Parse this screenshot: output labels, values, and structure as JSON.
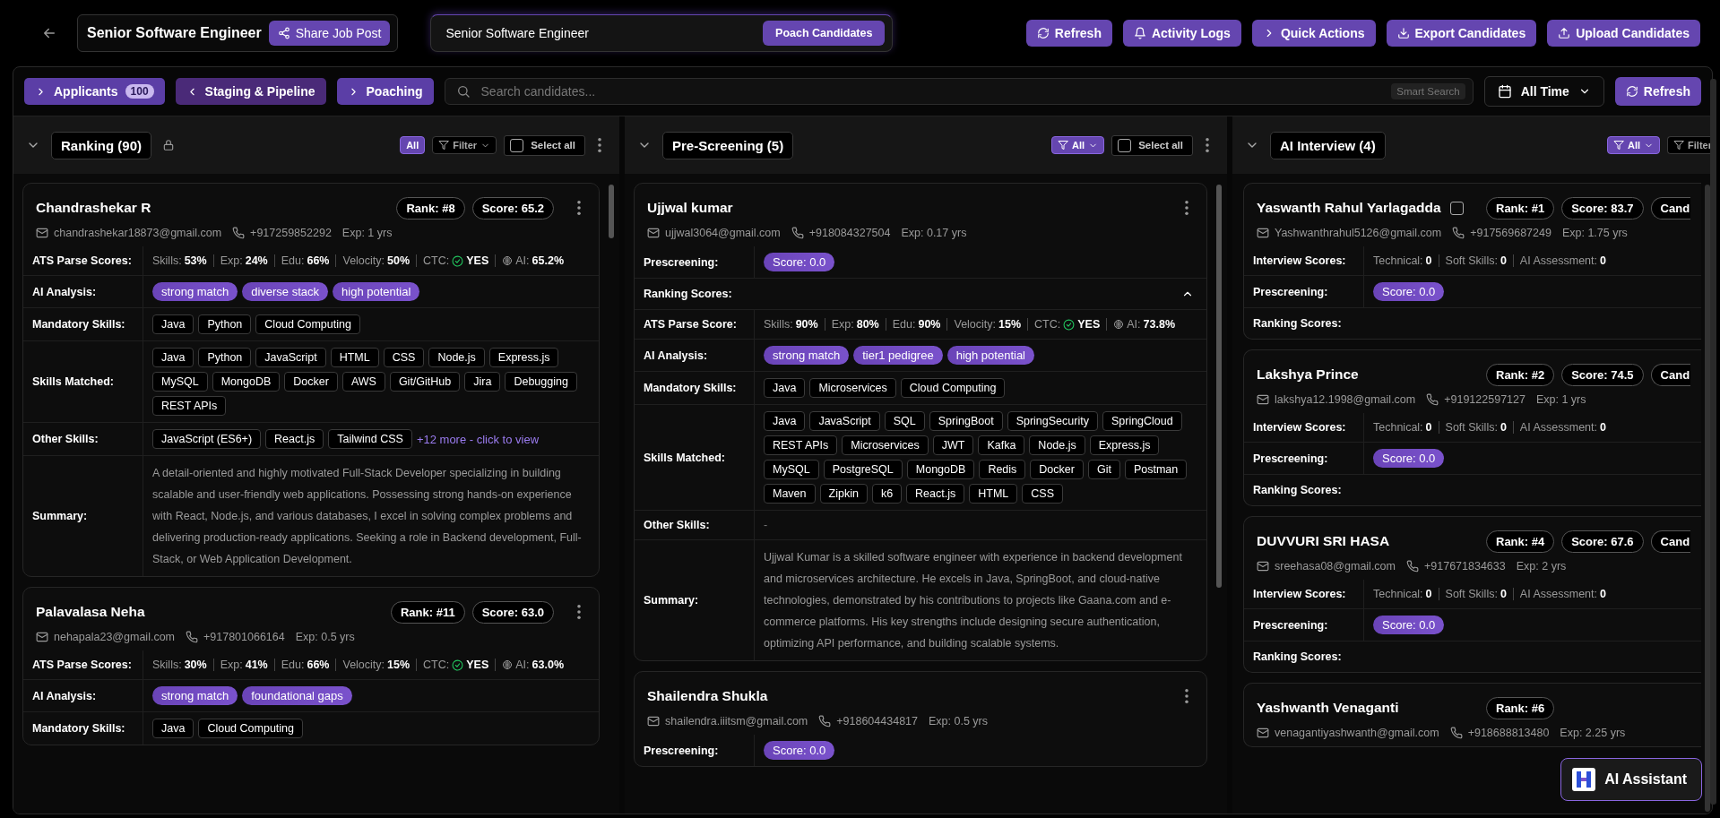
{
  "job_title": "Senior Software Engineer",
  "share_button": "Share Job Post",
  "poach_box": {
    "text": "Senior Software Engineer",
    "button": "Poach Candidates"
  },
  "actions": [
    {
      "label": "Refresh",
      "kind": "refresh"
    },
    {
      "label": "Activity Logs",
      "kind": "bell"
    },
    {
      "label": "Quick Actions",
      "kind": "chevron"
    },
    {
      "label": "Export Candidates",
      "kind": "download"
    },
    {
      "label": "Upload Candidates",
      "kind": "upload"
    }
  ],
  "stage_tabs": [
    {
      "label": "Applicants",
      "count": "100",
      "expanded": false
    },
    {
      "label": "Staging & Pipeline",
      "expanded": true
    },
    {
      "label": "Poaching",
      "expanded": false
    }
  ],
  "search": {
    "placeholder": "Search candidates...",
    "badge": "Smart Search"
  },
  "date_filter": "All Time",
  "refresh_button": "Refresh",
  "columns": [
    {
      "title": "Ranking (90)",
      "locked": true,
      "menu": true,
      "clipped": false,
      "controls": [
        {
          "kind": "chip",
          "label": "All",
          "selected": true
        },
        {
          "kind": "filter",
          "label": "Filter",
          "selected": false
        },
        {
          "kind": "select",
          "label": "Select all",
          "checked": false
        }
      ],
      "cards": [
        {
          "name": "Chandrashekar R",
          "menu": true,
          "badges": [
            {
              "label": "Rank: #8"
            },
            {
              "label": "Score: 65.2"
            }
          ],
          "email": "chandrashekar18873@gmail.com",
          "phone": "+917259852292",
          "exp": "Exp: 1 yrs",
          "rows": [
            {
              "kind": "scores",
              "label": "ATS Parse Scores:",
              "items": [
                {
                  "kind": "plain",
                  "label": "Skills:",
                  "value": "53%"
                },
                {
                  "kind": "plain",
                  "label": "Exp:",
                  "value": "24%"
                },
                {
                  "kind": "plain",
                  "label": "Edu:",
                  "value": "66%"
                },
                {
                  "kind": "plain",
                  "label": "Velocity:",
                  "value": "50%"
                },
                {
                  "kind": "ctc",
                  "label": "CTC:",
                  "value": "YES"
                },
                {
                  "kind": "ai",
                  "label": "AI:",
                  "value": "65.2%"
                }
              ]
            },
            {
              "kind": "tags",
              "label": "AI Analysis:",
              "items": [
                "strong match",
                "diverse stack",
                "high potential"
              ]
            },
            {
              "kind": "skills",
              "label": "Mandatory Skills:",
              "items": [
                "Java",
                "Python",
                "Cloud Computing"
              ]
            },
            {
              "kind": "skills",
              "label": "Skills Matched:",
              "items": [
                "Java",
                "Python",
                "JavaScript",
                "HTML",
                "CSS",
                "Node.js",
                "Express.js",
                "MySQL",
                "MongoDB",
                "Docker",
                "AWS",
                "Git/GitHub",
                "Jira",
                "Debugging",
                "REST APIs"
              ]
            },
            {
              "kind": "skills",
              "label": "Other Skills:",
              "items": [
                "JavaScript (ES6+)",
                "React.js",
                "Tailwind CSS"
              ],
              "more": "+12 more - click to view"
            },
            {
              "kind": "text",
              "label": "Summary:",
              "text": "A detail-oriented and highly motivated Full-Stack Developer specializing in building scalable and user-friendly web applications. Possessing strong hands-on experience with React, Node.js, and various databases, I excel in solving complex problems and delivering production-ready applications. Seeking a role in Backend development, Full-Stack, or Web Application Development."
            }
          ]
        },
        {
          "name": "Palavalasa Neha",
          "menu": true,
          "badges": [
            {
              "label": "Rank: #11"
            },
            {
              "label": "Score: 63.0"
            }
          ],
          "email": "nehapala23@gmail.com",
          "phone": "+917801066164",
          "exp": "Exp: 0.5 yrs",
          "rows": [
            {
              "kind": "scores",
              "label": "ATS Parse Scores:",
              "items": [
                {
                  "kind": "plain",
                  "label": "Skills:",
                  "value": "30%"
                },
                {
                  "kind": "plain",
                  "label": "Exp:",
                  "value": "41%"
                },
                {
                  "kind": "plain",
                  "label": "Edu:",
                  "value": "66%"
                },
                {
                  "kind": "plain",
                  "label": "Velocity:",
                  "value": "15%"
                },
                {
                  "kind": "ctc",
                  "label": "CTC:",
                  "value": "YES"
                },
                {
                  "kind": "ai",
                  "label": "AI:",
                  "value": "63.0%"
                }
              ]
            },
            {
              "kind": "tags",
              "label": "AI Analysis:",
              "items": [
                "strong match",
                "foundational gaps"
              ]
            },
            {
              "kind": "skills",
              "label": "Mandatory Skills:",
              "items": [
                "Java",
                "Cloud Computing"
              ]
            }
          ]
        }
      ]
    },
    {
      "title": "Pre-Screening (5)",
      "locked": false,
      "menu": true,
      "clipped": false,
      "controls": [
        {
          "kind": "filter",
          "label": "All",
          "selected": true
        },
        {
          "kind": "select",
          "label": "Select all",
          "checked": false
        }
      ],
      "cards": [
        {
          "name": "Ujjwal kumar",
          "menu": true,
          "email": "ujjwal3064@gmail.com",
          "phone": "+918084327504",
          "exp": "Exp: 0.17 yrs",
          "rows": [
            {
              "kind": "tags",
              "label": "Prescreening:",
              "items": [
                "Score: 0.0"
              ]
            },
            {
              "kind": "section",
              "label": "Ranking Scores:",
              "expanded": true
            },
            {
              "kind": "scores",
              "label": "ATS Parse Score:",
              "items": [
                {
                  "kind": "plain",
                  "label": "Skills:",
                  "value": "90%"
                },
                {
                  "kind": "plain",
                  "label": "Exp:",
                  "value": "80%"
                },
                {
                  "kind": "plain",
                  "label": "Edu:",
                  "value": "90%"
                },
                {
                  "kind": "plain",
                  "label": "Velocity:",
                  "value": "15%"
                },
                {
                  "kind": "ctc",
                  "label": "CTC:",
                  "value": "YES"
                },
                {
                  "kind": "ai",
                  "label": "AI:",
                  "value": "73.8%"
                }
              ]
            },
            {
              "kind": "tags",
              "label": "AI Analysis:",
              "items": [
                "strong match",
                "tier1 pedigree",
                "high potential"
              ]
            },
            {
              "kind": "skills",
              "label": "Mandatory Skills:",
              "items": [
                "Java",
                "Microservices",
                "Cloud Computing"
              ]
            },
            {
              "kind": "skills",
              "label": "Skills Matched:",
              "items": [
                "Java",
                "JavaScript",
                "SQL",
                "SpringBoot",
                "SpringSecurity",
                "SpringCloud",
                "REST APIs",
                "Microservices",
                "JWT",
                "Kafka",
                "Node.js",
                "Express.js",
                "MySQL",
                "PostgreSQL",
                "MongoDB",
                "Redis",
                "Docker",
                "Git",
                "Postman",
                "Maven",
                "Zipkin",
                "k6",
                "React.js",
                "HTML",
                "CSS"
              ]
            },
            {
              "kind": "empty",
              "label": "Other Skills:",
              "text": "-"
            },
            {
              "kind": "text",
              "label": "Summary:",
              "text": "Ujjwal Kumar is a skilled software engineer with experience in backend development and microservices architecture. He excels in Java, SpringBoot, and cloud-native technologies, demonstrated by his contributions to projects like Gaana.com and e-commerce platforms. His key strengths include designing secure authentication, optimizing API performance, and building scalable systems."
            }
          ]
        },
        {
          "name": "Shailendra Shukla",
          "menu": true,
          "email": "shailendra.iiitsm@gmail.com",
          "phone": "+918604434817",
          "exp": "Exp: 0.5 yrs",
          "rows": [
            {
              "kind": "tags",
              "label": "Prescreening:",
              "items": [
                "Score: 0.0"
              ]
            }
          ]
        }
      ]
    },
    {
      "title": "AI Interview (4)",
      "locked": false,
      "menu": false,
      "clipped": true,
      "controls": [
        {
          "kind": "filter",
          "label": "All",
          "selected": true
        },
        {
          "kind": "filter",
          "label": "Filter",
          "selected": false,
          "cut": true
        }
      ],
      "cards": [
        {
          "name": "Yaswanth Rahul Yarlagadda",
          "checked": false,
          "menu": false,
          "badges": [
            {
              "label": "Rank: #1"
            },
            {
              "label": "Score: 83.7"
            },
            {
              "label": "Cand",
              "cut": true
            }
          ],
          "email": "Yashwanthrahul5126@gmail.com",
          "phone": "+917569687249",
          "exp": "Exp: 1.75 yrs",
          "rows": [
            {
              "kind": "scores",
              "label": "Interview Scores:",
              "items": [
                {
                  "kind": "plain",
                  "label": "Technical:",
                  "value": "0"
                },
                {
                  "kind": "plain",
                  "label": "Soft Skills:",
                  "value": "0"
                },
                {
                  "kind": "plain",
                  "label": "AI Assessment:",
                  "value": "0"
                }
              ]
            },
            {
              "kind": "tags",
              "label": "Prescreening:",
              "items": [
                "Score: 0.0"
              ]
            },
            {
              "kind": "section",
              "label": "Ranking Scores:"
            }
          ]
        },
        {
          "name": "Lakshya Prince",
          "menu": false,
          "badges": [
            {
              "label": "Rank: #2"
            },
            {
              "label": "Score: 74.5"
            },
            {
              "label": "Cand",
              "cut": true
            }
          ],
          "email": "lakshya12.1998@gmail.com",
          "phone": "+919122597127",
          "exp": "Exp: 1 yrs",
          "rows": [
            {
              "kind": "scores",
              "label": "Interview Scores:",
              "items": [
                {
                  "kind": "plain",
                  "label": "Technical:",
                  "value": "0"
                },
                {
                  "kind": "plain",
                  "label": "Soft Skills:",
                  "value": "0"
                },
                {
                  "kind": "plain",
                  "label": "AI Assessment:",
                  "value": "0"
                }
              ]
            },
            {
              "kind": "tags",
              "label": "Prescreening:",
              "items": [
                "Score: 0.0"
              ]
            },
            {
              "kind": "section",
              "label": "Ranking Scores:"
            }
          ]
        },
        {
          "name": "DUVVURI SRI HASA",
          "menu": false,
          "badges": [
            {
              "label": "Rank: #4"
            },
            {
              "label": "Score: 67.6"
            },
            {
              "label": "Cand",
              "cut": true
            }
          ],
          "email": "sreehasa08@gmail.com",
          "phone": "+917671834633",
          "exp": "Exp: 2 yrs",
          "rows": [
            {
              "kind": "scores",
              "label": "Interview Scores:",
              "items": [
                {
                  "kind": "plain",
                  "label": "Technical:",
                  "value": "0"
                },
                {
                  "kind": "plain",
                  "label": "Soft Skills:",
                  "value": "0"
                },
                {
                  "kind": "plain",
                  "label": "AI Assessment:",
                  "value": "0"
                }
              ]
            },
            {
              "kind": "tags",
              "label": "Prescreening:",
              "items": [
                "Score: 0.0"
              ]
            },
            {
              "kind": "section",
              "label": "Ranking Scores:"
            }
          ]
        },
        {
          "name": "Yashwanth Venaganti",
          "menu": false,
          "badges": [
            {
              "label": "Rank: #6"
            }
          ],
          "email": "venagantiyashwanth@gmail.com",
          "phone": "+918688813480",
          "exp": "Exp: 2.25 yrs"
        }
      ]
    }
  ],
  "assistant_button": "AI Assistant"
}
